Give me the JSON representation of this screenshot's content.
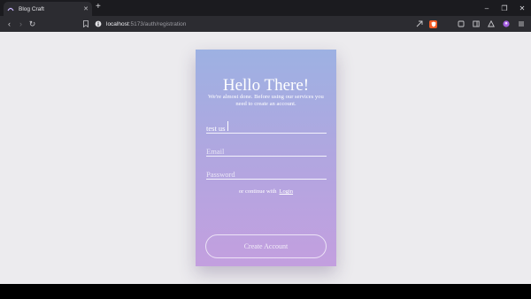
{
  "browser": {
    "tab": {
      "title": "Blog Craft",
      "close": "✕"
    },
    "new_tab": "+",
    "window_controls": {
      "minimize": "–",
      "maximize": "❐",
      "close": "✕"
    },
    "nav": {
      "back": "‹",
      "forward": "›",
      "reload": "↻"
    },
    "url_host": "localhost",
    "url_path": ":5173/auth/registration",
    "icons": [
      "bookmark-icon",
      "site-info-icon",
      "share-icon",
      "brave-shields-icon",
      "extensions-icon",
      "sidebar-icon",
      "rewards-icon",
      "profile-icon",
      "menu-icon"
    ],
    "brave_color": "#f15a24"
  },
  "form": {
    "title": "Hello There!",
    "subtitle": "We're almost done. Before using our services you need to create an account.",
    "name_value": "test us",
    "email_placeholder": "Email",
    "password_placeholder": "Password",
    "continue_text": "or continue with",
    "login_link": "Login",
    "submit_label": "Create Account",
    "gradient": [
      "#9db1e2",
      "#c39fdf"
    ]
  }
}
